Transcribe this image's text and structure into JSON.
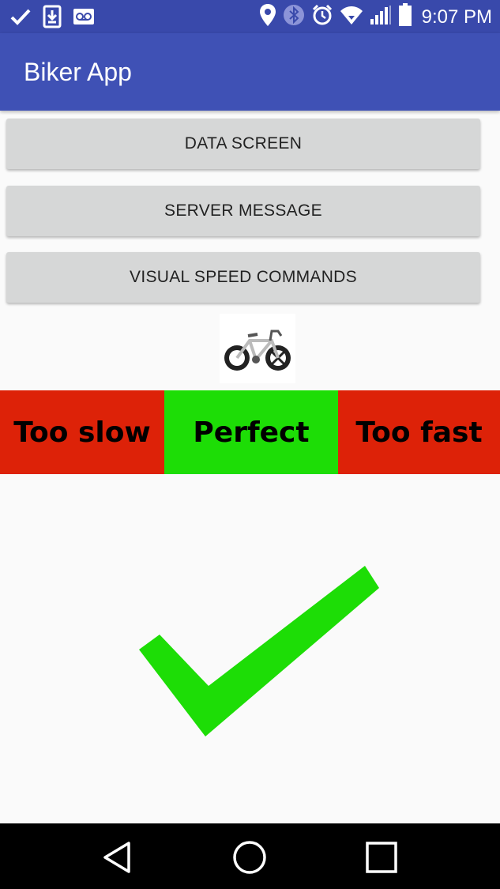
{
  "status_bar": {
    "time": "9:07 PM",
    "left_icons": [
      "check-icon",
      "download-icon",
      "voicemail-icon"
    ],
    "right_icons": [
      "location-icon",
      "bluetooth-icon",
      "alarm-icon",
      "wifi-icon",
      "signal-icon",
      "battery-icon"
    ]
  },
  "app_bar": {
    "title": "Biker App"
  },
  "buttons": {
    "data_screen": "DATA SCREEN",
    "server_message": "SERVER MESSAGE",
    "visual_speed_commands": "VISUAL SPEED COMMANDS"
  },
  "speed_indicator": {
    "too_slow": "Too slow",
    "perfect": "Perfect",
    "too_fast": "Too fast",
    "active": "perfect"
  },
  "colors": {
    "status_bar": "#3949ab",
    "app_bar": "#3f51b5",
    "too_slow": "#dd2208",
    "perfect": "#1ddd06",
    "too_fast": "#dd2208",
    "check": "#1ddd06"
  },
  "nav_bar": {
    "icons": [
      "back-icon",
      "home-icon",
      "recents-icon"
    ]
  }
}
